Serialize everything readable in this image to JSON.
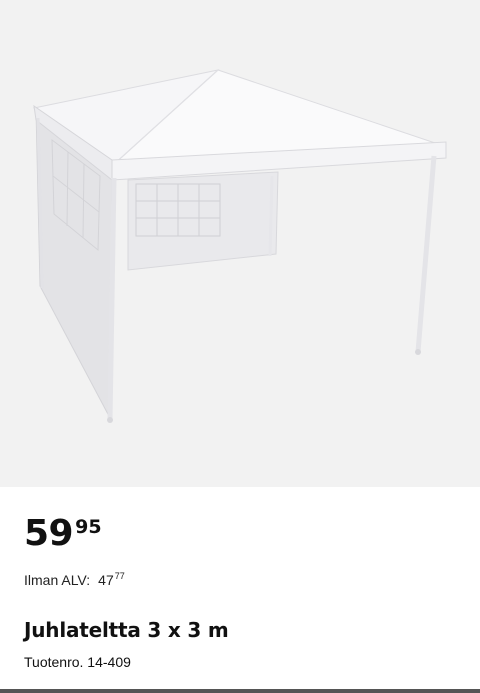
{
  "product": {
    "image_alt": "Juhlateltta 3 x 3 m",
    "price_main": "59",
    "price_cents": "95",
    "vat_label": "Ilman ALV:",
    "vat_main": "47",
    "vat_cents": "77",
    "title": "Juhlateltta 3 x 3 m",
    "product_number": "Tuotenro. 14-409"
  }
}
